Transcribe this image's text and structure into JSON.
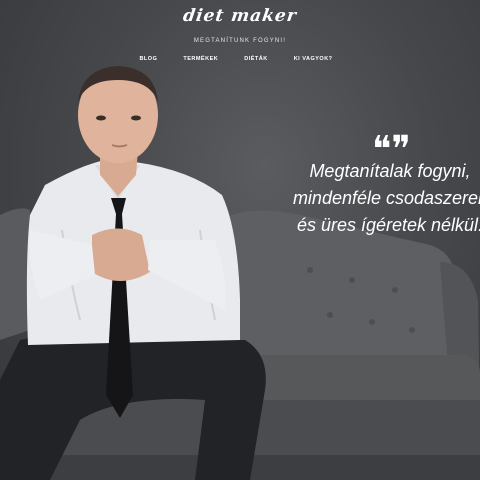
{
  "header": {
    "logo_text": "diet maker",
    "tagline": "MEGTANÍTUNK FOGYNI!"
  },
  "nav": {
    "items": [
      "BLOG",
      "TERMÉKEK",
      "DIÉTÁK",
      "KI VAGYOK?"
    ]
  },
  "hero": {
    "quote_marks": "❝❞",
    "quote_lines": [
      "Megtanítalak fogyni,",
      "mindenféle csodaszerek",
      "és üres ígéretek nélkül."
    ]
  },
  "colors": {
    "background": "#46484c",
    "sofa": "#5e5f62",
    "shirt": "#e9eaee",
    "suit": "#222326",
    "tie": "#151517"
  }
}
